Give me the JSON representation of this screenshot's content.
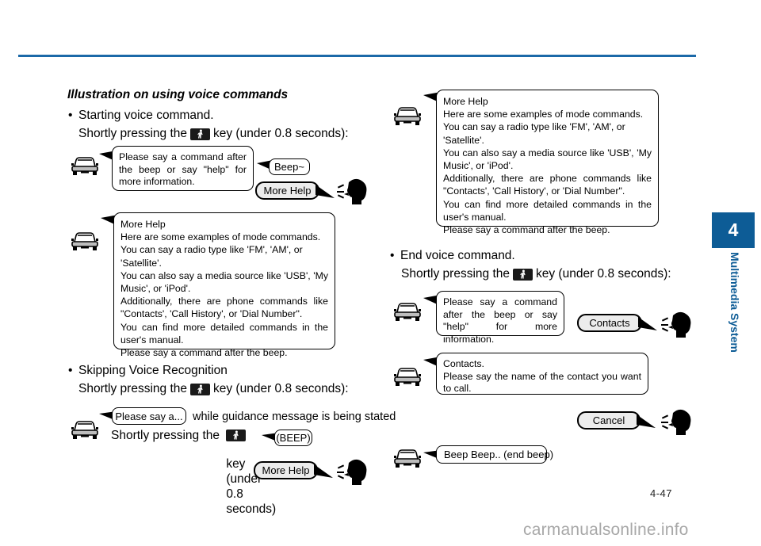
{
  "meta": {
    "page_number": "4-47",
    "watermark": "carmanualsonline.info",
    "accent_color": "#0d5c96",
    "rule_color": "#1b69a8"
  },
  "chapter_tab": {
    "number": "4",
    "label": "Multimedia System"
  },
  "content": {
    "heading": "Illustration on using voice commands",
    "sections": [
      {
        "bullet": "Starting voice command.",
        "instruction_prefix": "Shortly pressing the",
        "instruction_suffix": "key (under 0.8 seconds):"
      },
      {
        "bullet": "Skipping Voice Recognition",
        "instruction_prefix": "Shortly pressing the",
        "instruction_suffix": "key (under 0.8 seconds):"
      },
      {
        "bullet": "End voice command.",
        "instruction_prefix": "Shortly pressing the",
        "instruction_suffix": "key (under 0.8 seconds):"
      }
    ],
    "left_column": {
      "bubble_1": {
        "lines": [
          "Please say a command after the beep or say \"help\" for more information."
        ]
      },
      "beep_pill": "Beep~",
      "more_help_pill": "More Help",
      "bubble_2": {
        "title": "More Help",
        "lines": [
          "Here are some examples of mode commands.",
          "You can say a radio type like 'FM', 'AM', or 'Satellite'.",
          "You can also say a media source like 'USB', 'My Music', or 'iPod'.",
          "Additionally, there are phone commands like \"Contacts', 'Call History', or 'Dial Number\".",
          "You can find more detailed commands in the user's manual.",
          "Please say a command after the beep."
        ]
      },
      "please_say_pill": "Please say a...",
      "guidance_note": "while guidance message is being stated",
      "second_press_line1": "Shortly pressing the",
      "second_press_line2": "key (under 0.8 seconds)",
      "beep_pill_2": "(BEEP)",
      "more_help_pill_2": "More Help"
    },
    "right_column": {
      "bubble_3": {
        "title": "More Help",
        "lines": [
          "Here are some examples of mode commands.",
          "You can say a radio type like 'FM', 'AM', or 'Satellite'.",
          "You can also say a media source like 'USB', 'My Music', or 'iPod'.",
          "Additionally, there are phone commands like \"Contacts', 'Call History', or 'Dial Number\".",
          "You can find more detailed commands in the user's manual.",
          "Please say a command after the beep."
        ]
      },
      "bubble_4": {
        "lines": [
          "Please say a command after the beep or say \"help\" for more information."
        ]
      },
      "contacts_pill": "Contacts",
      "bubble_5": {
        "title": "Contacts.",
        "lines": [
          "Please say the name of the contact you want to call."
        ]
      },
      "cancel_pill": "Cancel",
      "end_beep_pill": "Beep Beep.. (end beep)"
    }
  },
  "icons": {
    "car": "car-front-icon",
    "head": "speaking-head-icon",
    "voice_key": "voice-command-key-icon"
  }
}
